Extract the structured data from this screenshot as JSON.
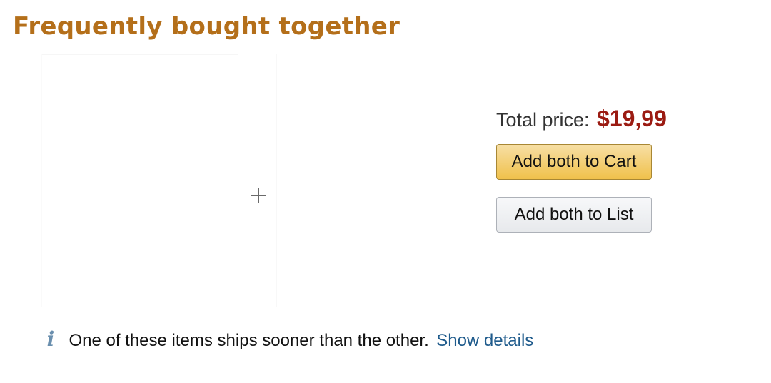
{
  "section": {
    "title": "Frequently bought together"
  },
  "bundle": {
    "total_label": "Total price:",
    "total_value": "$19,99",
    "add_to_cart_label": "Add both to Cart",
    "add_to_list_label": "Add both to List"
  },
  "notice": {
    "icon": "info-icon",
    "icon_glyph": "i",
    "text": "One of these items ships sooner than the other.",
    "link_label": "Show details"
  },
  "colors": {
    "title": "#b46f1a",
    "price": "#9b1b12",
    "cart_button": "#f0c14b",
    "list_button": "#e7e9ec",
    "link": "#1f5b8c",
    "info_icon": "#6a8fae"
  }
}
